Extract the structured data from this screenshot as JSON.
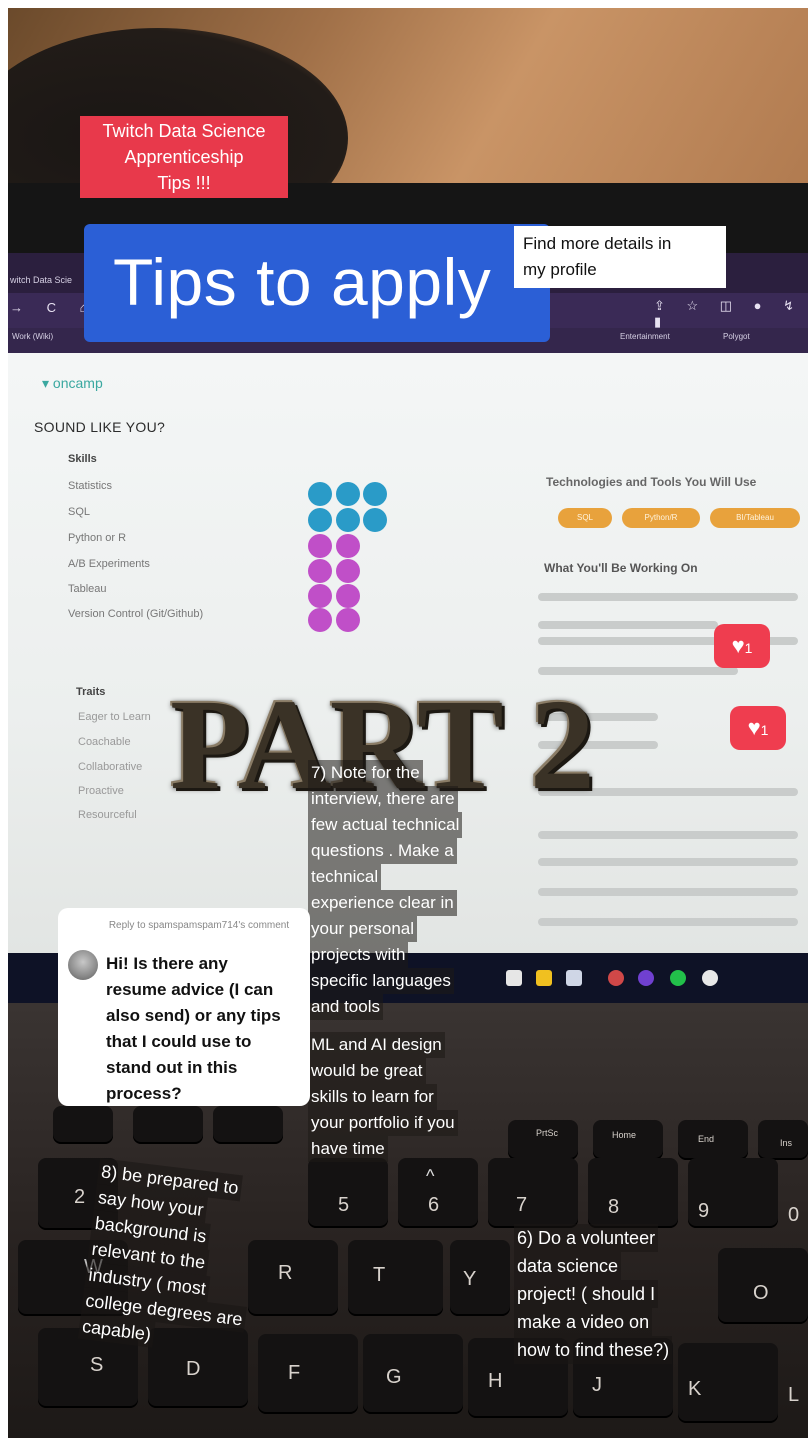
{
  "overlay": {
    "red_tag": [
      "Twitch Data Science",
      "Apprenticeship",
      "Tips !!!"
    ],
    "banner_title": "Tips to apply",
    "find_more": [
      "Find more details in",
      "my profile"
    ],
    "part_label": "PART 2",
    "tip7": [
      "7) Note for the",
      "interview, there are",
      "few actual technical",
      "questions . Make a",
      "technical",
      "experience clear in",
      "your personal",
      "projects with",
      "specific languages",
      "and tools"
    ],
    "ml_note": [
      "ML and AI design",
      "would be great",
      "skills to learn for",
      "your portfolio if you",
      "have time"
    ],
    "tip8": [
      "8) be prepared to",
      "say how your",
      "background is",
      "relevant to the",
      "industry ( most",
      "college degrees are",
      "capable)"
    ],
    "tip6": [
      "6) Do a volunteer",
      "data science",
      "project! ( should I",
      "make a video on",
      "how to find these?)"
    ],
    "likes": [
      "1",
      "1"
    ]
  },
  "comment_reply": {
    "reply_to": "Reply to spamspamspam714's comment",
    "question": [
      "Hi! Is there any",
      "resume advice (I can",
      "also send) or any tips",
      "that I could use to",
      "stand out in this",
      "process?"
    ]
  },
  "screen": {
    "logo": "oncamp",
    "heading": "SOUND LIKE YOU?",
    "skills_heading": "Skills",
    "skills": [
      "Statistics",
      "SQL",
      "Python or R",
      "A/B Experiments",
      "Tableau",
      "Version Control (Git/Github)"
    ],
    "traits_heading": "Traits",
    "traits": [
      "Eager to Learn",
      "Coachable",
      "Collaborative",
      "Proactive",
      "Resourceful"
    ],
    "tech_heading": "Technologies and Tools You Will Use",
    "tech_pills": [
      "SQL",
      "Python/R",
      "BI/Tableau"
    ],
    "work_heading": "What You'll Be Working On",
    "browser_tab": "witch Data Scie",
    "bookmarks": [
      "Work (Wiki)",
      "Entertainment",
      "Polygot"
    ]
  },
  "keyboard": {
    "keys": [
      "2",
      "5",
      "6",
      "7",
      "8",
      "9",
      "0",
      "R",
      "T",
      "Y",
      "O",
      "S",
      "D",
      "F",
      "G",
      "H",
      "J",
      "K",
      "L",
      "W"
    ],
    "fn_keys": [
      "PrtSc",
      "Home",
      "End",
      "Ins"
    ]
  },
  "colors": {
    "red_tag": "#e8394b",
    "banner_blue": "#2b5fd6",
    "dot_teal": "#2a9bc8",
    "dot_magenta": "#c04fc8",
    "pill_orange": "#e8a23c",
    "heart_red": "#ef3d4f"
  }
}
